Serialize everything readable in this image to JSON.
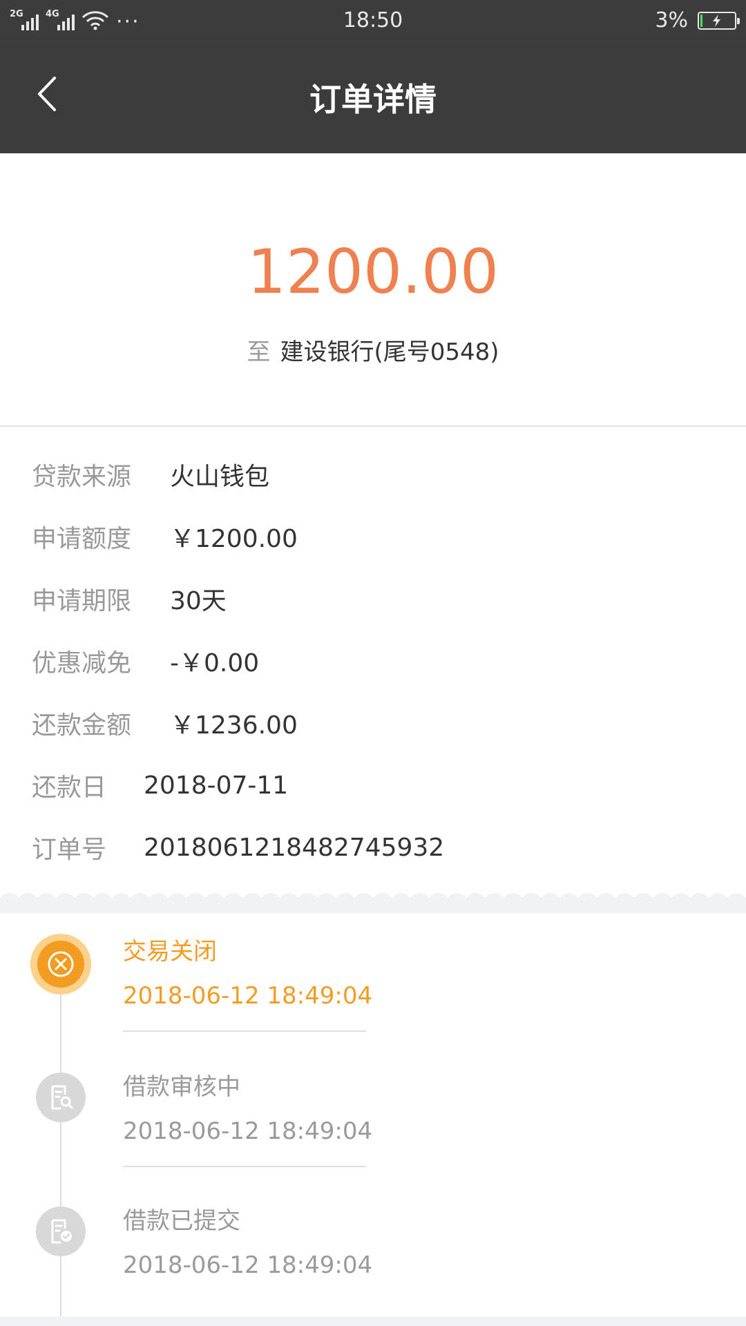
{
  "status_bar": {
    "network_1": "2G",
    "network_2": "4G",
    "more": "···",
    "time": "18:50",
    "battery_percent": "3%"
  },
  "header": {
    "title": "订单详情"
  },
  "amount_section": {
    "amount": "1200.00",
    "to_label": "至",
    "bank": "建设银行(尾号0548)"
  },
  "details": [
    {
      "label": "贷款来源",
      "value": "火山钱包"
    },
    {
      "label": "申请额度",
      "value": "￥1200.00"
    },
    {
      "label": "申请期限",
      "value": "30天"
    },
    {
      "label": "优惠减免",
      "value": "-￥0.00"
    },
    {
      "label": "还款金额",
      "value": "￥1236.00"
    },
    {
      "label": "还款日",
      "value": "2018-07-11"
    },
    {
      "label": "订单号",
      "value": "2018061218482745932"
    }
  ],
  "timeline": [
    {
      "title": "交易关闭",
      "time": "2018-06-12 18:49:04",
      "icon": "close-circle-icon",
      "state": "active"
    },
    {
      "title": "借款审核中",
      "time": "2018-06-12 18:49:04",
      "icon": "document-search-icon",
      "state": "inactive"
    },
    {
      "title": "借款已提交",
      "time": "2018-06-12 18:49:04",
      "icon": "document-check-icon",
      "state": "inactive"
    }
  ],
  "colors": {
    "header_bg": "#3c3c3c",
    "amount": "#ef8150",
    "active_orange": "#f39c22",
    "label_gray": "#999999",
    "value_dark": "#333333"
  }
}
